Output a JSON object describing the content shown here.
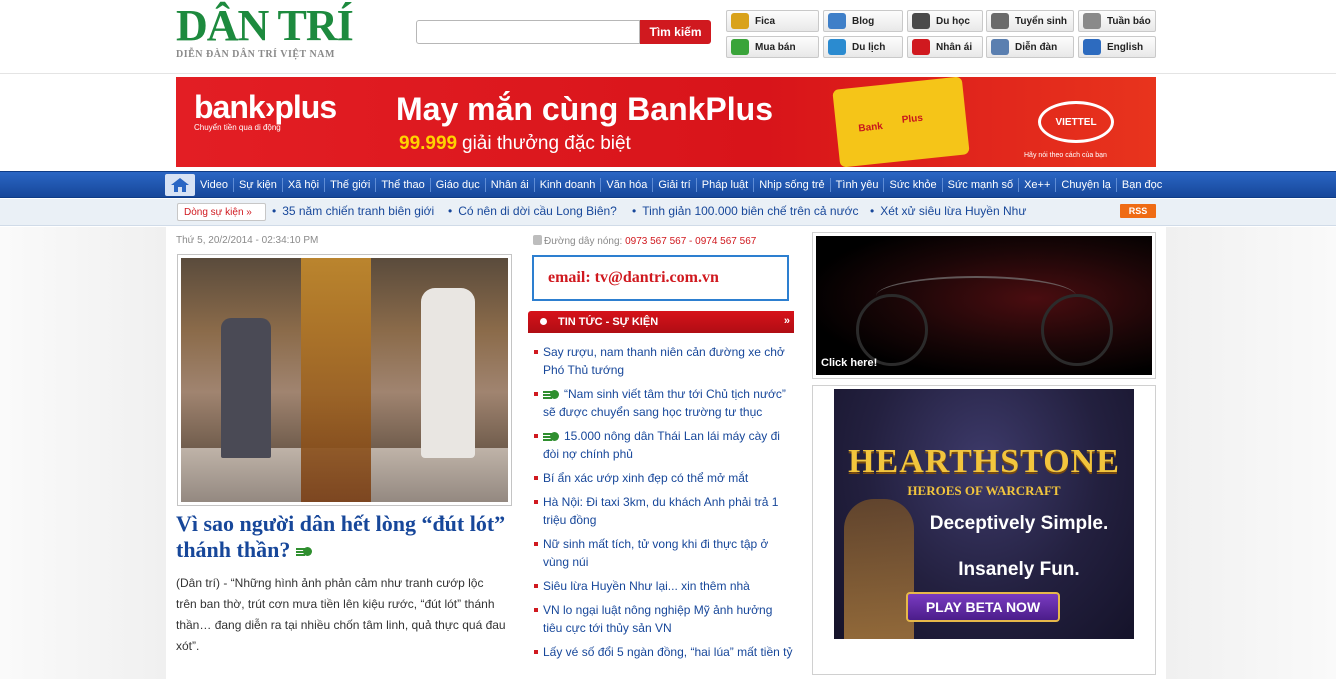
{
  "header": {
    "logo_text": "DÂN TRÍ",
    "logo_tagline": "DIỄN ĐÀN DÂN TRÍ VIỆT NAM",
    "search_placeholder": "",
    "search_button": "Tìm kiếm",
    "tools": [
      {
        "label": "Fica",
        "icon": "coins-icon",
        "color": "#d9a21b"
      },
      {
        "label": "Blog",
        "icon": "blog-icon",
        "color": "#3f7fc8"
      },
      {
        "label": "Du học",
        "icon": "graduation-cap-icon",
        "color": "#4a4a4a"
      },
      {
        "label": "Tuyển sinh",
        "icon": "student-icon",
        "color": "#6a6a6a"
      },
      {
        "label": "Tuần báo",
        "icon": "newspaper-icon",
        "color": "#8a8a8a"
      },
      {
        "label": "Mua bán",
        "icon": "shopping-bag-icon",
        "color": "#3aa43a"
      },
      {
        "label": "Du lịch",
        "icon": "travel-icon",
        "color": "#2b8bd0"
      },
      {
        "label": "Nhân ái",
        "icon": "heart-icon",
        "color": "#d0191f"
      },
      {
        "label": "Diễn đàn",
        "icon": "forum-icon",
        "color": "#5a7fb0"
      },
      {
        "label": "English",
        "icon": "book-icon",
        "color": "#2d6bbf"
      }
    ]
  },
  "banner": {
    "brand": "bank›plus",
    "brand_sub": "Chuyển tiền qua di động",
    "headline": "May mắn cùng BankPlus",
    "prize_number": "99.999",
    "prize_text": "giải thưởng đặc biệt",
    "puzzle_1": "Bank",
    "puzzle_2": "Plus",
    "partner": "VIETTEL",
    "partner_slogan": "Hãy nói theo cách của bạn"
  },
  "nav": {
    "items": [
      "Video",
      "Sự kiện",
      "Xã hội",
      "Thế giới",
      "Thể thao",
      "Giáo dục",
      "Nhân ái",
      "Kinh doanh",
      "Văn hóa",
      "Giải trí",
      "Pháp luật",
      "Nhịp sống trẻ",
      "Tình yêu",
      "Sức khỏe",
      "Sức mạnh số",
      "Xe++",
      "Chuyện lạ",
      "Bạn đọc"
    ]
  },
  "hot": {
    "label": "Dòng sự kiện »",
    "items": [
      "35 năm chiến tranh biên giới",
      "Có nên di dời cầu Long Biên?",
      "Tinh giản 100.000 biên chế trên cả nước",
      "Xét xử siêu lừa Huyền Như"
    ],
    "rss": "RSS"
  },
  "article": {
    "date": "Thứ 5, 20/2/2014 - 02:34:10 PM",
    "headline": "Vì sao người dân hết lòng “đút lót” thánh thần?",
    "summary": "(Dân trí) - “Những hình ảnh phản cảm như tranh cướp lộc trên ban thờ, trút cơn mưa tiền lên kiệu rước, “đút lót” thánh thần… đang diễn ra tại nhiều chốn tâm linh, quả thực quá đau xót”."
  },
  "middle": {
    "hotline_label": "Đường dây nóng:",
    "hotline_numbers": "0973 567 567 - 0974 567 567",
    "email": "email: tv@dantri.com.vn",
    "section_title": "TIN TỨC - SỰ KIỆN",
    "news": [
      {
        "text": "Say rượu, nam thanh niên cản đường xe chở Phó Thủ tướng",
        "video": false
      },
      {
        "text": "“Nam sinh viết tâm thư tới Chủ tịch nước” sẽ được chuyển sang học trường tư thục",
        "video": true
      },
      {
        "text": "15.000 nông dân Thái Lan lái máy cày đi đòi nợ chính phủ",
        "video": true
      },
      {
        "text": "Bí ẩn xác ướp xinh đẹp có thể mở mắt",
        "video": false
      },
      {
        "text": "Hà Nội: Đi taxi 3km, du khách Anh phải trả 1 triệu đồng",
        "video": false
      },
      {
        "text": "Nữ sinh mất tích, tử vong khi đi thực tập ở vùng núi",
        "video": false
      },
      {
        "text": "Siêu lừa Huyền Như lại... xin thêm nhà",
        "video": false
      },
      {
        "text": "VN lo ngại luật nông nghiệp Mỹ ảnh hưởng tiêu cực tới thủy sản VN",
        "video": false
      },
      {
        "text": "Lấy vé số đổi 5 ngàn đồng, “hai lúa” mất tiền tỷ",
        "video": false
      }
    ]
  },
  "ads": {
    "moto_click": "Click here!",
    "hs_title": "HEARTHSTONE",
    "hs_sub": "HEROES OF WARCRAFT",
    "hs_line1": "Deceptively Simple.",
    "hs_line2": "Insanely Fun.",
    "hs_button": "PLAY BETA NOW"
  }
}
